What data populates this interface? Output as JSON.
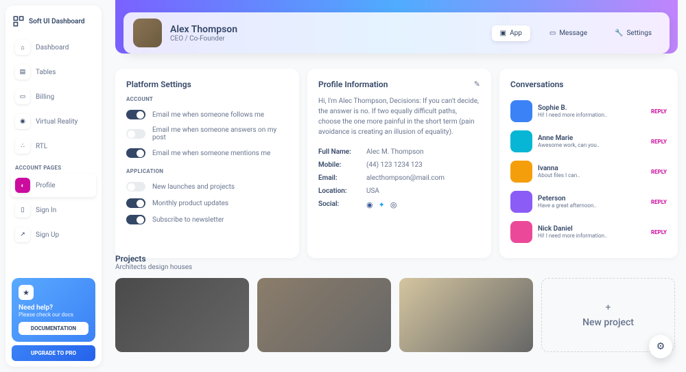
{
  "brand": "Soft UI Dashboard",
  "nav": {
    "items": [
      "Dashboard",
      "Tables",
      "Billing",
      "Virtual Reality",
      "RTL"
    ],
    "section": "ACCOUNT PAGES",
    "pages": [
      "Profile",
      "Sign In",
      "Sign Up"
    ]
  },
  "help": {
    "title": "Need help?",
    "sub": "Please check our docs",
    "doc": "DOCUMENTATION",
    "upgrade": "UPGRADE TO PRO"
  },
  "profile": {
    "name": "Alex Thompson",
    "role": "CEO / Co-Founder"
  },
  "tabs": {
    "app": "App",
    "message": "Message",
    "settings": "Settings"
  },
  "settings_card": {
    "title": "Platform Settings",
    "account": "ACCOUNT",
    "application": "APPLICATION",
    "opts": [
      {
        "label": "Email me when someone follows me",
        "on": true
      },
      {
        "label": "Email me when someone answers on my post",
        "on": false
      },
      {
        "label": "Email me when someone mentions me",
        "on": true
      }
    ],
    "app_opts": [
      {
        "label": "New launches and projects",
        "on": false
      },
      {
        "label": "Monthly product updates",
        "on": true
      },
      {
        "label": "Subscribe to newsletter",
        "on": true
      }
    ]
  },
  "info_card": {
    "title": "Profile Information",
    "bio": "Hi, I'm Alec Thompson, Decisions: If you can't decide, the answer is no. If two equally difficult paths, choose the one more painful in the short term (pain avoidance is creating an illusion of equality).",
    "rows": {
      "name_l": "Full Name:",
      "name_v": "Alec M. Thompson",
      "mobile_l": "Mobile:",
      "mobile_v": "(44) 123 1234 123",
      "email_l": "Email:",
      "email_v": "alecthompson@mail.com",
      "loc_l": "Location:",
      "loc_v": "USA",
      "social_l": "Social:"
    }
  },
  "convo_card": {
    "title": "Conversations",
    "reply": "REPLY",
    "items": [
      {
        "name": "Sophie B.",
        "msg": "Hi! I need more information..",
        "c": "#3b82f6"
      },
      {
        "name": "Anne Marie",
        "msg": "Awesome work, can you..",
        "c": "#06b6d4"
      },
      {
        "name": "Ivanna",
        "msg": "About files I can..",
        "c": "#f59e0b"
      },
      {
        "name": "Peterson",
        "msg": "Have a great afternoon..",
        "c": "#8b5cf6"
      },
      {
        "name": "Nick Daniel",
        "msg": "Hi! I need more information..",
        "c": "#ec4899"
      }
    ]
  },
  "projects": {
    "title": "Projects",
    "sub": "Architects design houses",
    "new": "New project",
    "imgs": [
      "#4a4a4a",
      "#8b7d6b",
      "#d4c5a0"
    ]
  }
}
